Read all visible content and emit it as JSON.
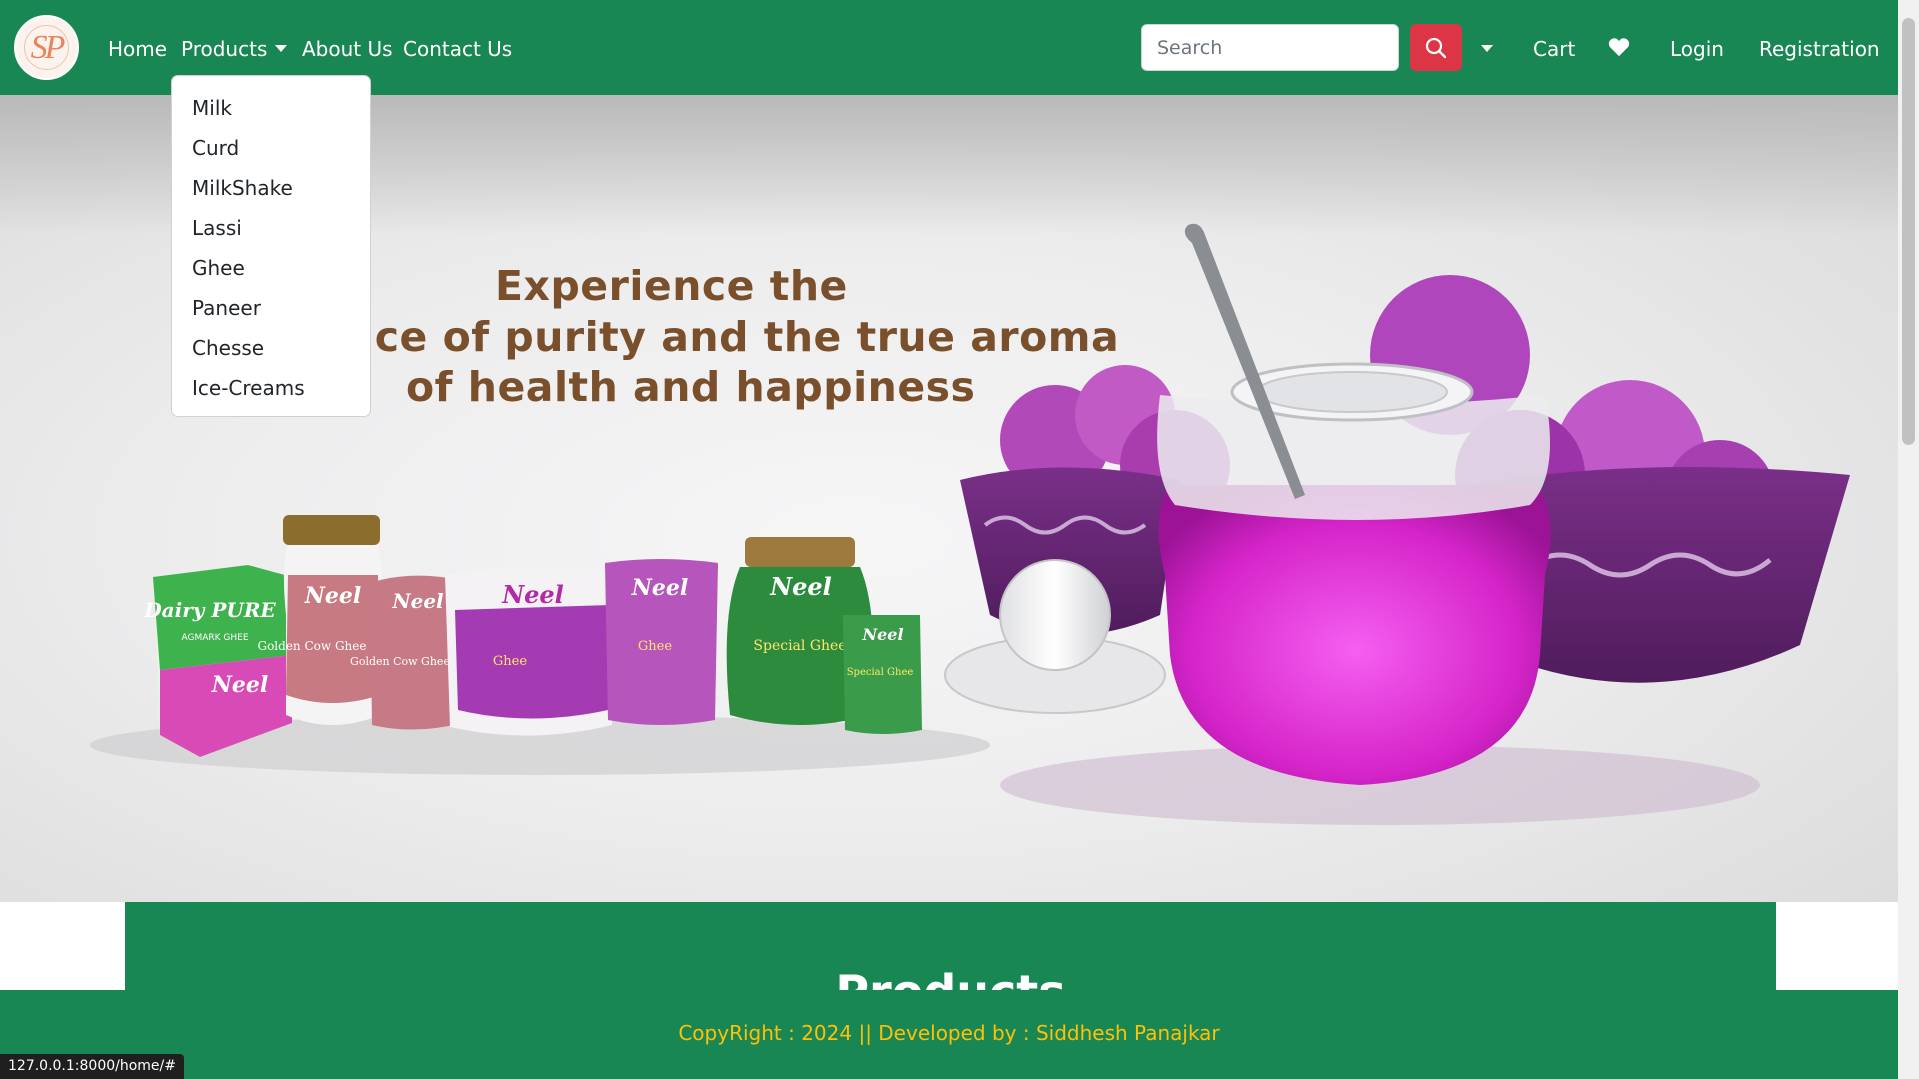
{
  "nav": {
    "logo_text": "SP",
    "links": [
      "Home",
      "Products",
      "About Us",
      "Contact Us"
    ],
    "search_placeholder": "Search",
    "right_links": [
      "Cart",
      "Login",
      "Registration"
    ]
  },
  "products_menu": [
    "Milk",
    "Curd",
    "MilkShake",
    "Lassi",
    "Ghee",
    "Paneer",
    "Chesse",
    "Ice-Creams"
  ],
  "hero": {
    "line1": "Experience the",
    "line2": "nce of purity and the true aroma",
    "line3": "of health and happiness",
    "brand_marks": [
      "Neel",
      "Neel",
      "Neel",
      "Neel",
      "Neel",
      "Neel",
      "Neel"
    ],
    "box_brand": "Dairy PURE",
    "box_sub": "AGMARK GHEE",
    "pack_labels": [
      "Golden Cow Ghee",
      "Golden Cow Ghee",
      "Ghee",
      "Ghee",
      "Special Ghee",
      "Special Ghee"
    ]
  },
  "section": {
    "title": "Products"
  },
  "footer": {
    "text": "CopyRight : 2024 || Developed by : Siddhesh Panajkar"
  },
  "status_url": "127.0.0.1:8000/home/#",
  "colors": {
    "navbar": "#198754",
    "search_button": "#dc3545",
    "footer_text": "#ffc107",
    "heading": "#7a4f2c"
  }
}
